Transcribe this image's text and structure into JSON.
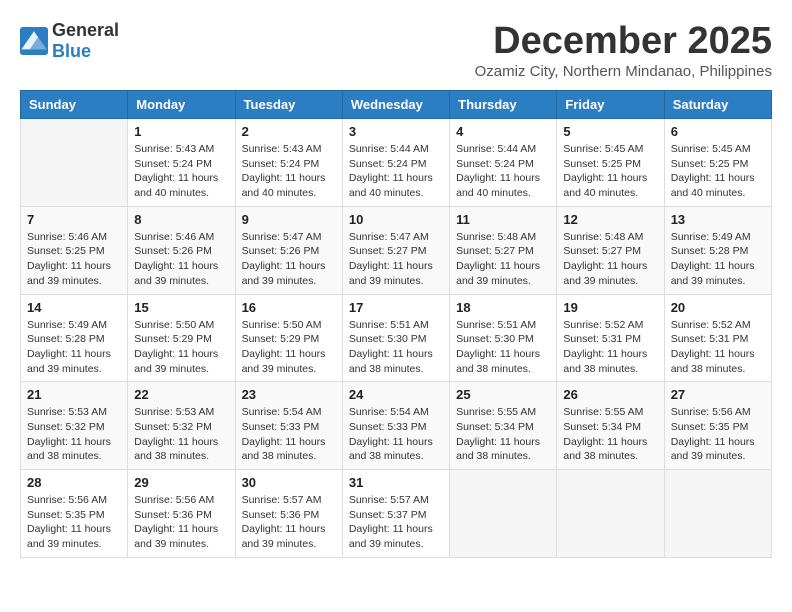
{
  "header": {
    "logo_general": "General",
    "logo_blue": "Blue",
    "month_year": "December 2025",
    "location": "Ozamiz City, Northern Mindanao, Philippines"
  },
  "columns": [
    "Sunday",
    "Monday",
    "Tuesday",
    "Wednesday",
    "Thursday",
    "Friday",
    "Saturday"
  ],
  "weeks": [
    [
      {
        "day": "",
        "sunrise": "",
        "sunset": "",
        "daylight": ""
      },
      {
        "day": "1",
        "sunrise": "5:43 AM",
        "sunset": "5:24 PM",
        "daylight": "11 hours and 40 minutes."
      },
      {
        "day": "2",
        "sunrise": "5:43 AM",
        "sunset": "5:24 PM",
        "daylight": "11 hours and 40 minutes."
      },
      {
        "day": "3",
        "sunrise": "5:44 AM",
        "sunset": "5:24 PM",
        "daylight": "11 hours and 40 minutes."
      },
      {
        "day": "4",
        "sunrise": "5:44 AM",
        "sunset": "5:24 PM",
        "daylight": "11 hours and 40 minutes."
      },
      {
        "day": "5",
        "sunrise": "5:45 AM",
        "sunset": "5:25 PM",
        "daylight": "11 hours and 40 minutes."
      },
      {
        "day": "6",
        "sunrise": "5:45 AM",
        "sunset": "5:25 PM",
        "daylight": "11 hours and 40 minutes."
      }
    ],
    [
      {
        "day": "7",
        "sunrise": "5:46 AM",
        "sunset": "5:25 PM",
        "daylight": "11 hours and 39 minutes."
      },
      {
        "day": "8",
        "sunrise": "5:46 AM",
        "sunset": "5:26 PM",
        "daylight": "11 hours and 39 minutes."
      },
      {
        "day": "9",
        "sunrise": "5:47 AM",
        "sunset": "5:26 PM",
        "daylight": "11 hours and 39 minutes."
      },
      {
        "day": "10",
        "sunrise": "5:47 AM",
        "sunset": "5:27 PM",
        "daylight": "11 hours and 39 minutes."
      },
      {
        "day": "11",
        "sunrise": "5:48 AM",
        "sunset": "5:27 PM",
        "daylight": "11 hours and 39 minutes."
      },
      {
        "day": "12",
        "sunrise": "5:48 AM",
        "sunset": "5:27 PM",
        "daylight": "11 hours and 39 minutes."
      },
      {
        "day": "13",
        "sunrise": "5:49 AM",
        "sunset": "5:28 PM",
        "daylight": "11 hours and 39 minutes."
      }
    ],
    [
      {
        "day": "14",
        "sunrise": "5:49 AM",
        "sunset": "5:28 PM",
        "daylight": "11 hours and 39 minutes."
      },
      {
        "day": "15",
        "sunrise": "5:50 AM",
        "sunset": "5:29 PM",
        "daylight": "11 hours and 39 minutes."
      },
      {
        "day": "16",
        "sunrise": "5:50 AM",
        "sunset": "5:29 PM",
        "daylight": "11 hours and 39 minutes."
      },
      {
        "day": "17",
        "sunrise": "5:51 AM",
        "sunset": "5:30 PM",
        "daylight": "11 hours and 38 minutes."
      },
      {
        "day": "18",
        "sunrise": "5:51 AM",
        "sunset": "5:30 PM",
        "daylight": "11 hours and 38 minutes."
      },
      {
        "day": "19",
        "sunrise": "5:52 AM",
        "sunset": "5:31 PM",
        "daylight": "11 hours and 38 minutes."
      },
      {
        "day": "20",
        "sunrise": "5:52 AM",
        "sunset": "5:31 PM",
        "daylight": "11 hours and 38 minutes."
      }
    ],
    [
      {
        "day": "21",
        "sunrise": "5:53 AM",
        "sunset": "5:32 PM",
        "daylight": "11 hours and 38 minutes."
      },
      {
        "day": "22",
        "sunrise": "5:53 AM",
        "sunset": "5:32 PM",
        "daylight": "11 hours and 38 minutes."
      },
      {
        "day": "23",
        "sunrise": "5:54 AM",
        "sunset": "5:33 PM",
        "daylight": "11 hours and 38 minutes."
      },
      {
        "day": "24",
        "sunrise": "5:54 AM",
        "sunset": "5:33 PM",
        "daylight": "11 hours and 38 minutes."
      },
      {
        "day": "25",
        "sunrise": "5:55 AM",
        "sunset": "5:34 PM",
        "daylight": "11 hours and 38 minutes."
      },
      {
        "day": "26",
        "sunrise": "5:55 AM",
        "sunset": "5:34 PM",
        "daylight": "11 hours and 38 minutes."
      },
      {
        "day": "27",
        "sunrise": "5:56 AM",
        "sunset": "5:35 PM",
        "daylight": "11 hours and 39 minutes."
      }
    ],
    [
      {
        "day": "28",
        "sunrise": "5:56 AM",
        "sunset": "5:35 PM",
        "daylight": "11 hours and 39 minutes."
      },
      {
        "day": "29",
        "sunrise": "5:56 AM",
        "sunset": "5:36 PM",
        "daylight": "11 hours and 39 minutes."
      },
      {
        "day": "30",
        "sunrise": "5:57 AM",
        "sunset": "5:36 PM",
        "daylight": "11 hours and 39 minutes."
      },
      {
        "day": "31",
        "sunrise": "5:57 AM",
        "sunset": "5:37 PM",
        "daylight": "11 hours and 39 minutes."
      },
      {
        "day": "",
        "sunrise": "",
        "sunset": "",
        "daylight": ""
      },
      {
        "day": "",
        "sunrise": "",
        "sunset": "",
        "daylight": ""
      },
      {
        "day": "",
        "sunrise": "",
        "sunset": "",
        "daylight": ""
      }
    ]
  ],
  "labels": {
    "sunrise": "Sunrise:",
    "sunset": "Sunset:",
    "daylight": "Daylight:"
  }
}
